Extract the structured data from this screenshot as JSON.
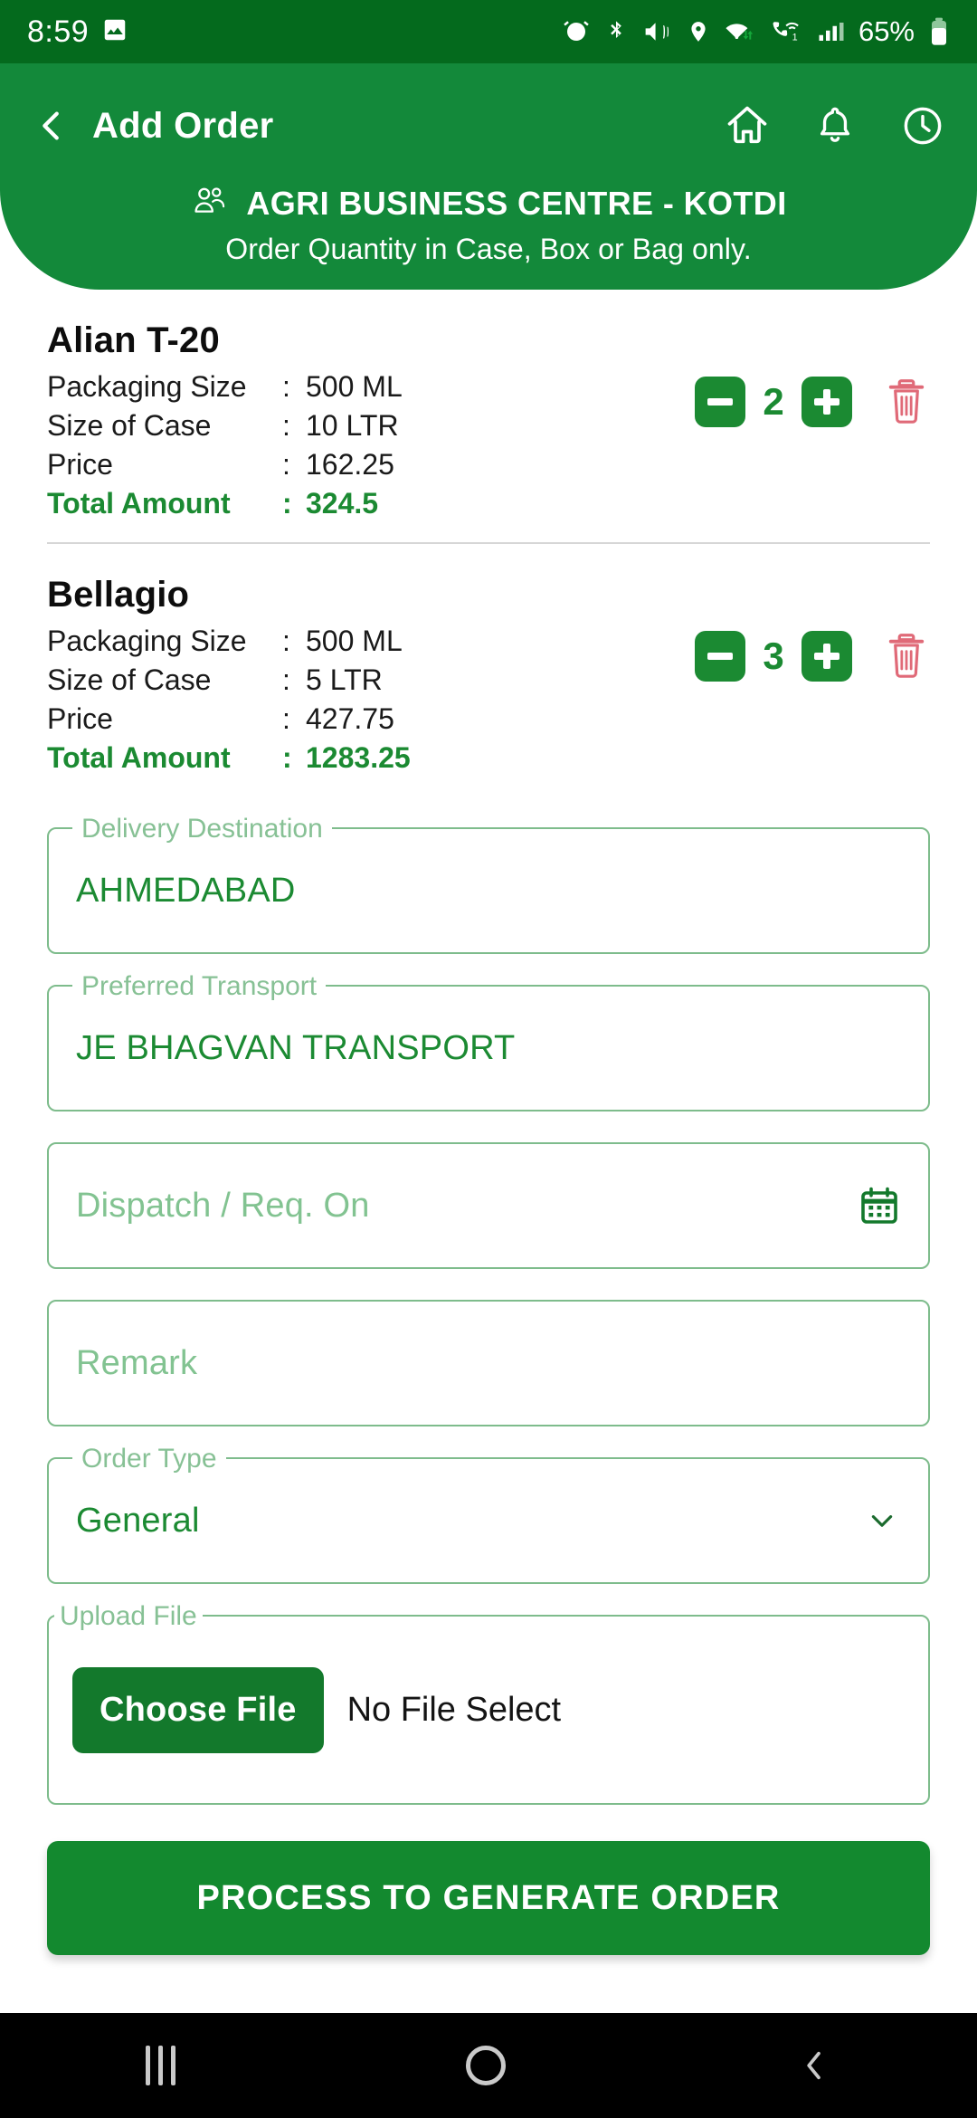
{
  "status_bar": {
    "time": "8:59",
    "battery_text": "65%",
    "left_icons": [
      "image-icon"
    ],
    "right_icons": [
      "alarm-icon",
      "bluetooth-icon",
      "vibrate-mute-icon",
      "location-icon",
      "wifi-transfer-icon",
      "wifi-calling-icon",
      "signal-bars-icon",
      "battery-icon"
    ]
  },
  "header": {
    "back_label": "back-arrow",
    "title": "Add Order",
    "actions": [
      "home-icon",
      "bell-icon",
      "history-clock-icon"
    ],
    "centre_name": "AGRI BUSINESS CENTRE -  KOTDI",
    "note": "Order Quantity in Case, Box or Bag only."
  },
  "labels": {
    "packaging_size": "Packaging Size",
    "size_of_case": "Size of Case",
    "price": "Price",
    "total_amount": "Total Amount",
    "colon": ":"
  },
  "products": [
    {
      "name": "Alian T-20",
      "packaging_size": "500 ML",
      "size_of_case": "10 LTR",
      "price": "162.25",
      "total_amount": "324.5",
      "qty": "2"
    },
    {
      "name": "Bellagio",
      "packaging_size": "500 ML",
      "size_of_case": "5 LTR",
      "price": "427.75",
      "total_amount": "1283.25",
      "qty": "3"
    }
  ],
  "form": {
    "delivery_destination": {
      "label": "Delivery Destination",
      "value": "AHMEDABAD"
    },
    "preferred_transport": {
      "label": "Preferred Transport",
      "value": "JE BHAGVAN TRANSPORT"
    },
    "dispatch": {
      "placeholder": "Dispatch / Req. On",
      "value": "",
      "icon": "calendar-icon"
    },
    "remark": {
      "placeholder": "Remark",
      "value": ""
    },
    "order_type": {
      "label": "Order Type",
      "value": "General",
      "icon": "chevron-down-icon"
    },
    "upload_file": {
      "label": "Upload File",
      "button": "Choose File",
      "status": "No File Select"
    }
  },
  "cta": {
    "label": "PROCESS TO GENERATE ORDER"
  },
  "nav_bar": {
    "items": [
      "recents-icon",
      "home-icon",
      "back-icon"
    ]
  },
  "colors": {
    "status_bar_green": "#046A1D",
    "header_green": "#13893A",
    "accent_green": "#1B8A32",
    "field_border": "#7EBC8C",
    "field_label": "#87C195",
    "trash_red": "#E06A78"
  }
}
